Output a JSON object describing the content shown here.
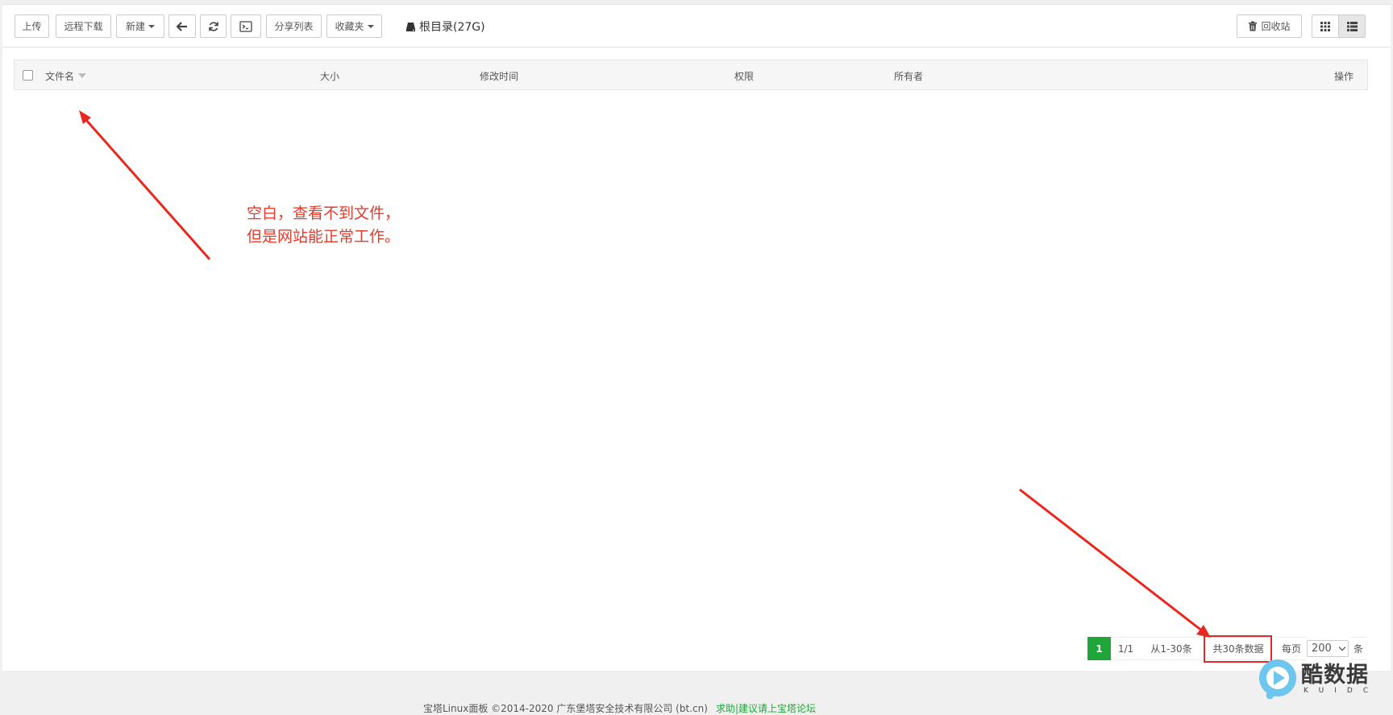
{
  "toolbar": {
    "upload": "上传",
    "remote_download": "远程下载",
    "new": "新建",
    "share_list": "分享列表",
    "favorites": "收藏夹",
    "root_dir": "根目录(27G)",
    "recycle_bin": "回收站"
  },
  "table": {
    "columns": [
      "文件名",
      "大小",
      "修改时间",
      "权限",
      "所有者",
      "操作"
    ]
  },
  "annotation": {
    "line1": "空白，查看不到文件，",
    "line2": "但是网站能正常工作。"
  },
  "pagination": {
    "current_page": "1",
    "page_of": "1/1",
    "range": "从1-30条",
    "total": "共30条数据",
    "per_page_label": "每页",
    "per_page_value": "200",
    "unit": "条"
  },
  "footer": {
    "copyright": "宝塔Linux面板 ©2014-2020 广东堡塔安全技术有限公司 (bt.cn)",
    "help_links": "求助|建议请上宝塔论坛"
  },
  "watermark": {
    "title": "酷数据",
    "subtitle": "KUIDC"
  },
  "colors": {
    "accent_green": "#20a53a",
    "annotation_red": "#e03c2d"
  }
}
